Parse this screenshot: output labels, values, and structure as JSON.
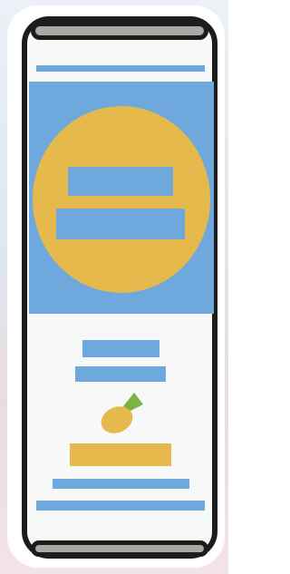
{
  "artwork": {
    "subject": "can-sticker",
    "colors": {
      "outline": "#1c1c1c",
      "can_body": "#f7f9f9",
      "metal_rim": "#a9a9a3",
      "accent_blue": "#6fa8dc",
      "accent_gold": "#e6b94d",
      "leaf_green": "#7cb342",
      "sticker_border": "#ffffff"
    },
    "icons": [
      "fruit-icon",
      "leaf-icon"
    ]
  }
}
